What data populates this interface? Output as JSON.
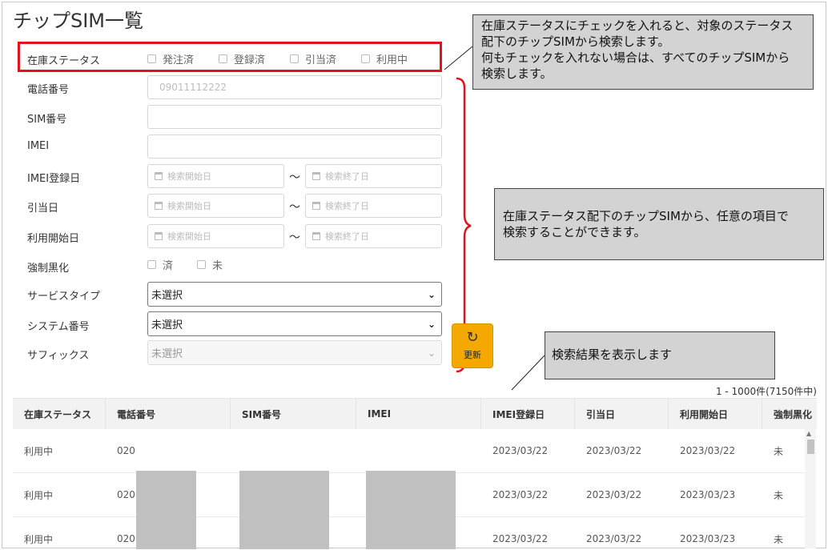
{
  "page": {
    "title": "チップSIM一覧"
  },
  "search": {
    "status": {
      "label": "在庫ステータス",
      "options": [
        "発注済",
        "登録済",
        "引当済",
        "利用中"
      ]
    },
    "phone": {
      "label": "電話番号",
      "placeholder": "09011112222"
    },
    "sim": {
      "label": "SIM番号"
    },
    "imei": {
      "label": "IMEI"
    },
    "imei_date": {
      "label": "IMEI登録日",
      "start": "検索開始日",
      "end": "検索終了日"
    },
    "alloc_date": {
      "label": "引当日",
      "start": "検索開始日",
      "end": "検索終了日"
    },
    "use_date": {
      "label": "利用開始日",
      "start": "検索開始日",
      "end": "検索終了日"
    },
    "tilde": "〜",
    "blackout": {
      "label": "強制黒化",
      "options": [
        "済",
        "未"
      ]
    },
    "service_type": {
      "label": "サービスタイプ",
      "value": "未選択"
    },
    "system_no": {
      "label": "システム番号",
      "value": "未選択"
    },
    "suffix": {
      "label": "サフィックス",
      "value": "未選択"
    },
    "refresh_label": "更新"
  },
  "callouts": {
    "status_note": [
      "在庫ステータスにチェックを入れると、対象のステータス",
      "配下のチップSIMから検索します。",
      "何もチェックを入れない場合は、すべてのチップSIMから",
      "検索します。"
    ],
    "fields_note": [
      "在庫ステータス配下のチップSIMから、任意の項目で",
      "検索することができます。"
    ],
    "results_note": [
      "検索結果を表示します"
    ]
  },
  "results": {
    "count": "1 - 1000件(7150件中)",
    "columns": [
      "在庫ステータス",
      "電話番号",
      "SIM番号",
      "IMEI",
      "IMEI登録日",
      "引当日",
      "利用開始日",
      "強制黒化"
    ],
    "rows": [
      {
        "status": "利用中",
        "phone": "020",
        "sim": "",
        "imei": "",
        "imei_date": "2023/03/22",
        "alloc_date": "2023/03/22",
        "use_date": "2023/03/22",
        "blackout": "未"
      },
      {
        "status": "利用中",
        "phone": "020",
        "sim": "",
        "imei": "",
        "imei_date": "2023/03/22",
        "alloc_date": "2023/03/22",
        "use_date": "2023/03/23",
        "blackout": "未"
      },
      {
        "status": "利用中",
        "phone": "020",
        "sim": "",
        "imei": "",
        "imei_date": "2023/03/22",
        "alloc_date": "2023/03/22",
        "use_date": "2023/03/23",
        "blackout": "未"
      }
    ]
  },
  "colors": {
    "highlight": "#e0141e",
    "refresh": "#f5a800",
    "callout": "#d3d3d3"
  }
}
